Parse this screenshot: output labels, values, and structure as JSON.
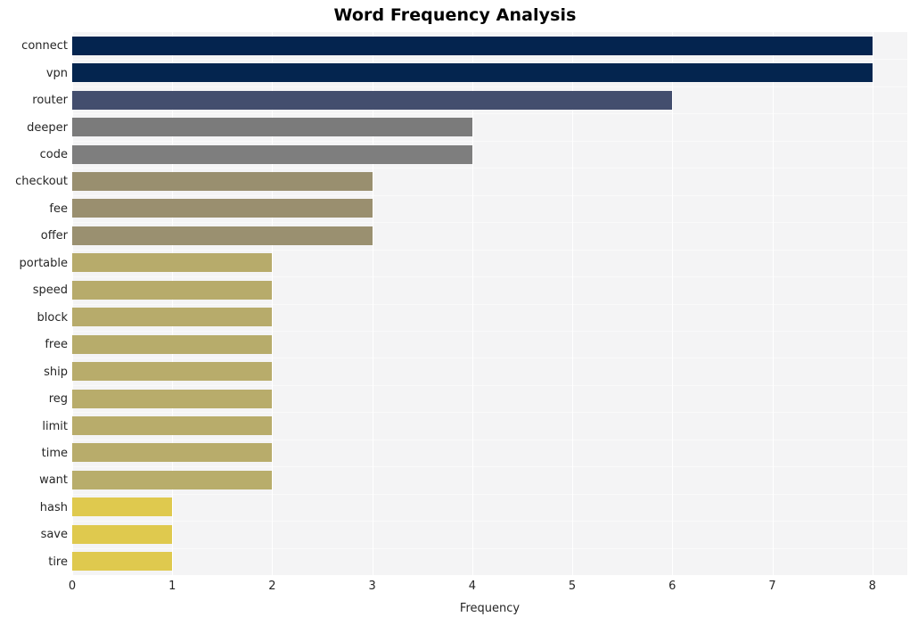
{
  "chart_data": {
    "type": "bar",
    "orientation": "horizontal",
    "title": "Word Frequency Analysis",
    "xlabel": "Frequency",
    "ylabel": "",
    "xlim": [
      0,
      8.35
    ],
    "ylim": [
      0,
      20
    ],
    "grid": true,
    "legend": null,
    "xticks": [
      "0",
      "1",
      "2",
      "3",
      "4",
      "5",
      "6",
      "7",
      "8"
    ],
    "xtick_values": [
      0,
      1,
      2,
      3,
      4,
      5,
      6,
      7,
      8
    ],
    "categories": [
      "connect",
      "vpn",
      "router",
      "deeper",
      "code",
      "checkout",
      "fee",
      "offer",
      "portable",
      "speed",
      "block",
      "free",
      "ship",
      "reg",
      "limit",
      "time",
      "want",
      "hash",
      "save",
      "tire"
    ],
    "values": [
      8,
      8,
      6,
      4,
      4,
      3,
      3,
      3,
      2,
      2,
      2,
      2,
      2,
      2,
      2,
      2,
      2,
      1,
      1,
      1
    ],
    "bar_colors": [
      "#04244f",
      "#04254f",
      "#434e6e",
      "#7b7b7b",
      "#7e7e7e",
      "#998f6f",
      "#9a8f6f",
      "#9a9070",
      "#b7ab6b",
      "#b7ab6b",
      "#b7ab6b",
      "#b7ac6b",
      "#b8ac6b",
      "#b8ac6b",
      "#b8ac6b",
      "#b8ac6b",
      "#b8ad6b",
      "#dfc94e",
      "#dfc94e",
      "#dfc94e"
    ],
    "plot_background": "#f4f4f5",
    "gridline_color": "#ffffff",
    "text_color": "#262626"
  }
}
